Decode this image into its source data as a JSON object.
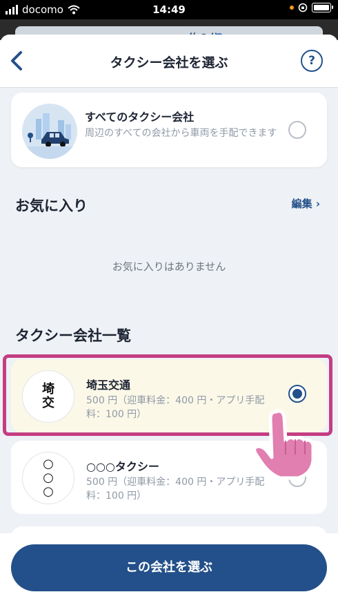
{
  "status_bar": {
    "carrier": "docomo",
    "time": "14:49"
  },
  "map_peek": {
    "eta": "約２分"
  },
  "header": {
    "title": "タクシー会社を選ぶ",
    "help": "?"
  },
  "all_companies": {
    "name": "すべてのタクシー会社",
    "description": "周辺のすべての会社から車両を手配できます"
  },
  "favorites": {
    "title": "お気に入り",
    "edit_label": "編集 ›",
    "empty_text": "お気に入りはありません"
  },
  "list": {
    "title": "タクシー会社一覧",
    "companies": [
      {
        "logo": [
          "埼",
          "交"
        ],
        "name": "埼玉交通",
        "price": "500 円（迎車料金：400 円・アプリ手配料：100 円）",
        "selected": true
      },
      {
        "logo": [
          "○",
          "○",
          "○"
        ],
        "name": "○○○タクシー",
        "price": "500 円（迎車料金：400 円・アプリ手配料：100 円）",
        "selected": false
      }
    ]
  },
  "action": {
    "select_label": "この会社を選ぶ"
  },
  "colors": {
    "primary": "#23508a",
    "highlight": "#c43d83",
    "selected_bg": "#fbf8e8"
  }
}
